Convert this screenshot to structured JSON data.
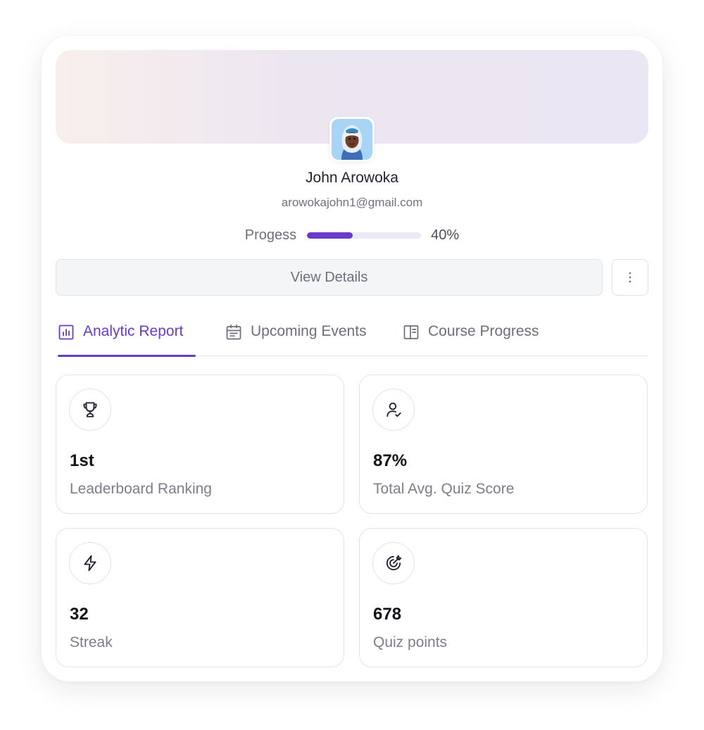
{
  "profile": {
    "name": "John Arowoka",
    "email": "arowokajohn1@gmail.com",
    "avatar_icon": "avatar-memoji-icon"
  },
  "progress": {
    "label": "Progess",
    "value": 0.4,
    "display": "40%"
  },
  "actions": {
    "view_details": "View Details",
    "more_icon": "more-vertical-icon"
  },
  "tabs": [
    {
      "label": "Analytic Report",
      "icon": "bar-chart-icon",
      "active": true
    },
    {
      "label": "Upcoming Events",
      "icon": "calendar-icon",
      "active": false
    },
    {
      "label": "Course Progress",
      "icon": "book-layout-icon",
      "active": false
    }
  ],
  "stats": [
    {
      "value": "1st",
      "label": "Leaderboard Ranking",
      "icon": "trophy-icon"
    },
    {
      "value": "87%",
      "label": "Total Avg. Quiz Score",
      "icon": "user-check-icon"
    },
    {
      "value": "32",
      "label": "Streak",
      "icon": "lightning-icon"
    },
    {
      "value": "678",
      "label": "Quiz points",
      "icon": "target-icon"
    }
  ],
  "colors": {
    "accent": "#6a3bc6",
    "track": "#ece9f6",
    "banner_start": "#f8efec",
    "banner_end": "#ebe6f4"
  }
}
